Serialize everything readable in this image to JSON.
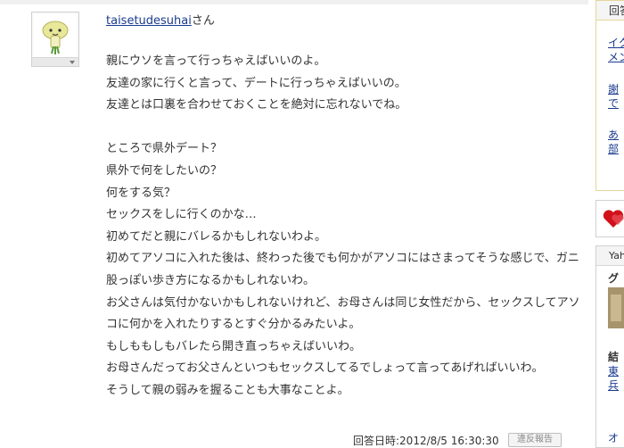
{
  "answer": {
    "author_name": "taisetudesuhai",
    "author_suffix": "さん",
    "lines": [
      "親にウソを言って行っちゃえばいいのよ。",
      "友達の家に行くと言って、デートに行っちゃえばいいの。",
      "友達とは口裏を合わせておくことを絶対に忘れないでね。",
      "",
      "ところで県外デート？",
      "県外で何をしたいの？",
      "何をする気？",
      "セックスをしに行くのかな…",
      "初めてだと親にバレるかもしれないわよ。",
      "初めてアソコに入れた後は、終わった後でも何かがアソコにはさまってそうな感じで、ガニ",
      "股っぽい歩き方になるかもしれないわ。",
      "お父さんは気付かないかもしれないけれど、お母さんは同じ女性だから、セックスしてアソ",
      "コに何かを入れたりするとすぐ分かるみたいよ。",
      "もしももしもバレたら開き直っちゃえばいいわ。",
      "お母さんだってお父さんといつもセックスしてるでしょって言ってあげればいいわ。",
      "そうして親の弱みを握ることも大事なことよ。"
    ],
    "answered_at": "回答日時:2012/8/5 16:30:30",
    "report_label": "違反報告"
  },
  "sidebar": {
    "box1_header": "回答",
    "box1_links": [
      "イク",
      "メン",
      "謝",
      "で",
      "あ",
      "部"
    ],
    "box3_header": "Yah",
    "box3_title": "グ",
    "box3_link_heading": "結",
    "box3_links": [
      "東",
      "兵"
    ],
    "bottom_link": "オ"
  },
  "colors": {
    "link": "#1a3a8f",
    "accent_border": "#e5d59a",
    "heart": "#d0121b"
  }
}
